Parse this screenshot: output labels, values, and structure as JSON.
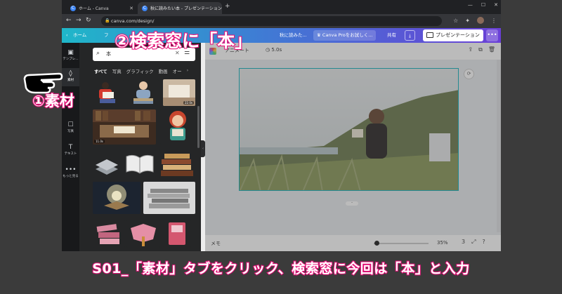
{
  "browser": {
    "tabs": [
      {
        "label": "ホーム - Canva",
        "active": false
      },
      {
        "label": "秋に読みたい本 - プレゼンテーション",
        "active": true
      }
    ],
    "new_tab": "+",
    "window_controls": [
      "—",
      "☐",
      "✕"
    ],
    "url": "canva.com/design/"
  },
  "canva_header": {
    "home": "ホーム",
    "file": "フ",
    "doc_title": "秋に読みた...",
    "pro_button": "Canva Proをお試しく...",
    "share": "共有",
    "download_icon": "download-icon",
    "present_button": "プレゼンテーション",
    "more": "•••"
  },
  "rail": [
    {
      "icon": "▣",
      "label": "テンプレ...",
      "active": false
    },
    {
      "icon": "◊",
      "label": "素材",
      "active": true
    },
    {
      "icon": "☐",
      "label": "写真",
      "active": false
    },
    {
      "icon": "T",
      "label": "テキスト",
      "active": false
    },
    {
      "icon": "•••",
      "label": "もっと見る",
      "active": false
    }
  ],
  "panel": {
    "search_value": "本",
    "categories": [
      "すべて",
      "写真",
      "グラフィック",
      "動画",
      "オー"
    ],
    "durations": [
      "22.0s",
      "11.0s"
    ]
  },
  "toolbar": {
    "animate": "アニメート",
    "timer": "5.0s"
  },
  "bottom": {
    "memo": "メモ",
    "zoom": "35%",
    "zoom_level": 0.0,
    "page_count": "3"
  },
  "annotations": {
    "search_note": "②検索窓に「本」",
    "material_note": "①素材",
    "caption": "S01_「素材」タブをクリック、検索窓に今回は「本」と入力"
  },
  "colors": {
    "annotation_outline": "#e8127a",
    "canvas_border": "#16b3bd"
  }
}
